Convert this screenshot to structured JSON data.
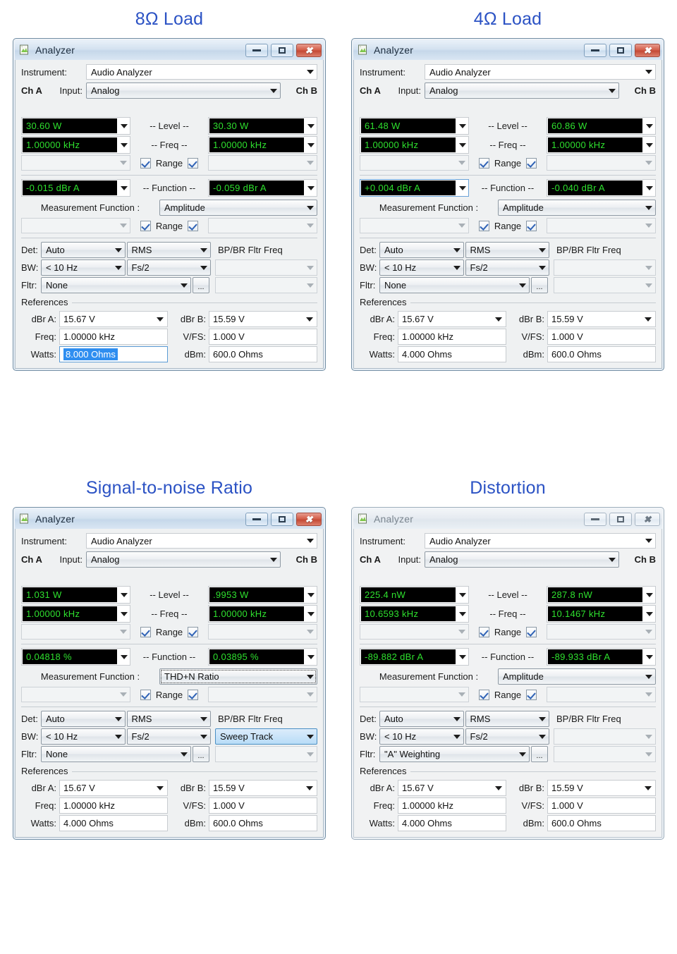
{
  "page": {
    "accent_blue": "#2b52c4",
    "meter_green": "#2ee02e",
    "selection_blue": "#2f8ef0"
  },
  "common": {
    "window_title": "Analyzer",
    "app_icon": "analyzer-document-icon",
    "minimize_label": "minimize-icon",
    "maximize_label": "maximize-icon",
    "close_label": "close-icon",
    "instrument_label": "Instrument:",
    "instrument_value": "Audio Analyzer",
    "ch_a": "Ch A",
    "ch_b": "Ch B",
    "input_label": "Input:",
    "input_value": "Analog",
    "level_label": "-- Level --",
    "freq_label": "-- Freq --",
    "function_label": "-- Function --",
    "range_label": "Range",
    "meas_func_label": "Measurement Function :",
    "det_label": "Det:",
    "bw_label": "BW:",
    "fltr_label": "Fltr:",
    "det_value": "Auto",
    "det_value2": "RMS",
    "bw_value": "< 10 Hz",
    "bw_value2": "Fs/2",
    "bpbr_title": "BP/BR Fltr Freq",
    "dots_button": "...",
    "references_label": "References",
    "dbra_label": "dBr A:",
    "dbrb_label": "dBr B:",
    "freq_ref_label": "Freq:",
    "vfs_label": "V/FS:",
    "watts_label": "Watts:",
    "dbm_label": "dBm:",
    "dbra_value": "15.67   V",
    "dbrb_value": "15.59   V",
    "freq_ref_value": "1.00000 kHz",
    "vfs_value": "1.000   V",
    "dbm_value": "600.0   Ohms"
  },
  "panels": [
    {
      "id": "panel-8ohm",
      "title": "8Ω Load",
      "active": true,
      "level_a": "30.60   W",
      "level_b": "30.30   W",
      "freq_a": "1.00000 kHz",
      "freq_b": "1.00000 kHz",
      "function_a": "-0.015   dBr A",
      "function_b": "-0.059   dBr A",
      "function_a_focused": false,
      "meas_function": "Amplitude",
      "meas_function_focus_dot": false,
      "fltr_value": "None",
      "bpbr_value": "",
      "bpbr_highlight": false,
      "watts_value": "8.000   Ohms",
      "watts_selected": true
    },
    {
      "id": "panel-4ohm",
      "title": "4Ω Load",
      "active": true,
      "level_a": "61.48   W",
      "level_b": "60.86   W",
      "freq_a": "1.00000 kHz",
      "freq_b": "1.00000 kHz",
      "function_a": "+0.004   dBr A",
      "function_b": "-0.040   dBr A",
      "function_a_focused": true,
      "meas_function": "Amplitude",
      "meas_function_focus_dot": false,
      "fltr_value": "None",
      "bpbr_value": "",
      "bpbr_highlight": false,
      "watts_value": "4.000   Ohms",
      "watts_selected": false
    },
    {
      "id": "panel-snr",
      "title": "Signal-to-noise Ratio",
      "active": true,
      "level_a": "1.031   W",
      "level_b": ".9953   W",
      "freq_a": "1.00000 kHz",
      "freq_b": "1.00000 kHz",
      "function_a": "0.04818 %",
      "function_b": "0.03895 %",
      "function_a_focused": false,
      "meas_function": "THD+N Ratio",
      "meas_function_focus_dot": true,
      "fltr_value": "None",
      "bpbr_value": "Sweep Track",
      "bpbr_highlight": true,
      "watts_value": "4.000   Ohms",
      "watts_selected": false
    },
    {
      "id": "panel-distortion",
      "title": "Distortion",
      "active": false,
      "level_a": "225.4   nW",
      "level_b": "287.8   nW",
      "freq_a": "10.6593 kHz",
      "freq_b": "10.1467 kHz",
      "function_a": "-89.882 dBr A",
      "function_b": "-89.933 dBr A",
      "function_a_focused": false,
      "meas_function": "Amplitude",
      "meas_function_focus_dot": false,
      "fltr_value": "\"A\" Weighting",
      "bpbr_value": "",
      "bpbr_highlight": false,
      "watts_value": "4.000   Ohms",
      "watts_selected": false
    }
  ]
}
